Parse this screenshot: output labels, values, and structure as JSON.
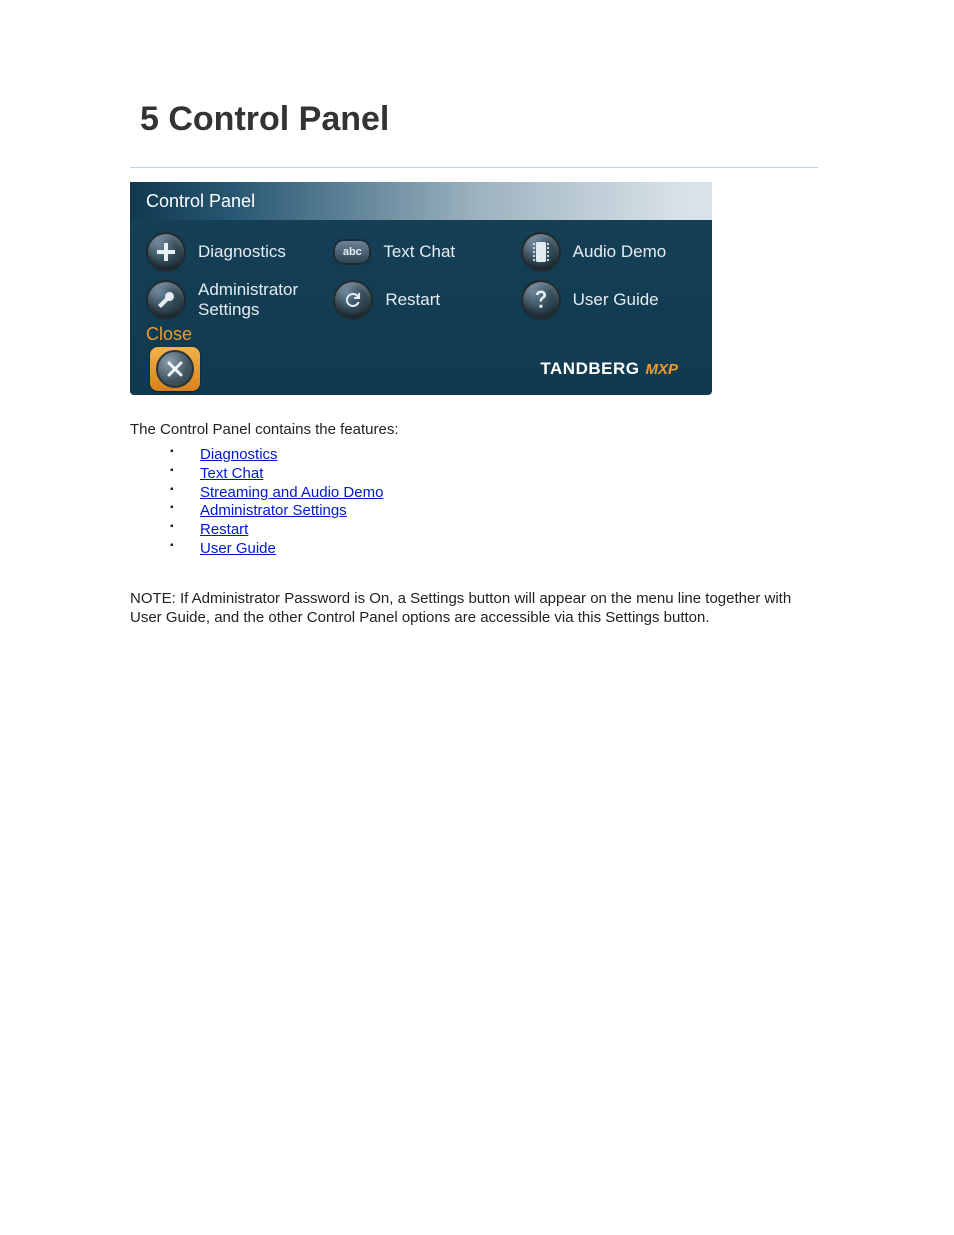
{
  "page": {
    "title": "5 Control Panel",
    "intro": "The Control Panel contains the features:",
    "note": "NOTE: If Administrator Password is On, a Settings button will appear on the menu line together with User Guide, and the other Control Panel options are accessible via this Settings button."
  },
  "panel": {
    "header_title": "Control Panel",
    "items": [
      {
        "label": "Diagnostics",
        "icon": "plus"
      },
      {
        "label": "Text Chat",
        "icon": "abc"
      },
      {
        "label": "Audio Demo",
        "icon": "film"
      },
      {
        "label": "Administrator\nSettings",
        "icon": "wrench"
      },
      {
        "label": "Restart",
        "icon": "refresh"
      },
      {
        "label": "User Guide",
        "icon": "question"
      }
    ],
    "close_label": "Close",
    "brand_name": "TANDBERG",
    "brand_sub": "MXP"
  },
  "links": [
    {
      "text": "Diagnostics"
    },
    {
      "text": "Text Chat"
    },
    {
      "text": "Streaming and Audio Demo"
    },
    {
      "text": "Administrator Settings"
    },
    {
      "text": "Restart"
    },
    {
      "text": "User Guide"
    }
  ]
}
